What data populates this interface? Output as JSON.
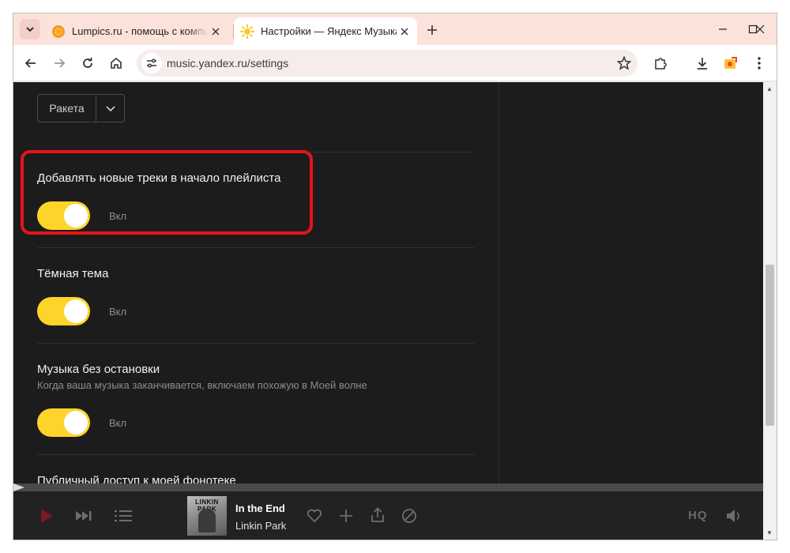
{
  "browser": {
    "tabs": [
      {
        "title": "Lumpics.ru - помощь с компьютером",
        "favicon": "lumpics-orange-icon",
        "active": false
      },
      {
        "title": "Настройки — Яндекс Музыка",
        "favicon": "yandex-music-sun-icon",
        "active": true
      }
    ],
    "url": "music.yandex.ru/settings"
  },
  "settings": {
    "select_value": "Ракета",
    "items": [
      {
        "title": "Добавлять новые треки в начало плейлиста",
        "description": "",
        "toggle_label": "Вкл",
        "on": true
      },
      {
        "title": "Тёмная тема",
        "description": "",
        "toggle_label": "Вкл",
        "on": true
      },
      {
        "title": "Музыка без остановки",
        "description": "Когда ваша музыка заканчивается, включаем похожую в Моей волне",
        "toggle_label": "Вкл",
        "on": true
      },
      {
        "title": "Публичный доступ к моей фонотеке"
      }
    ],
    "accent_color": "#fed42b",
    "highlight_color": "#e5141b"
  },
  "player": {
    "track_title": "In the End",
    "artist": "Linkin Park",
    "cover_text": "LINKIN PARK",
    "quality_label": "HQ",
    "progress": 0
  }
}
